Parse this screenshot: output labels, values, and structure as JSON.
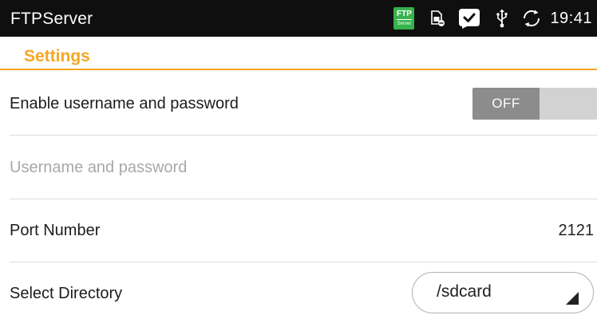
{
  "status_bar": {
    "app_title": "FTPServer",
    "ftp_badge_main": "FTP",
    "ftp_badge_sub": "Server",
    "time": "19:41",
    "icons": [
      "ftp-server-icon",
      "sim-card-icon",
      "check-icon",
      "usb-icon",
      "sync-icon"
    ]
  },
  "settings": {
    "header": "Settings",
    "enable_credentials": {
      "label": "Enable username and password",
      "toggle_state": "OFF"
    },
    "credentials": {
      "label": "Username and password",
      "enabled": false
    },
    "port": {
      "label": "Port Number",
      "value": "2121"
    },
    "directory": {
      "label": "Select Directory",
      "selected": "/sdcard"
    }
  },
  "colors": {
    "accent": "#f5a623",
    "status_bar": "#0f0f0f",
    "ftp_badge": "#37b24d",
    "toggle_off_knob": "#8c8c8c",
    "toggle_track": "#d2d2d2",
    "disabled_text": "#a8a8a8"
  }
}
